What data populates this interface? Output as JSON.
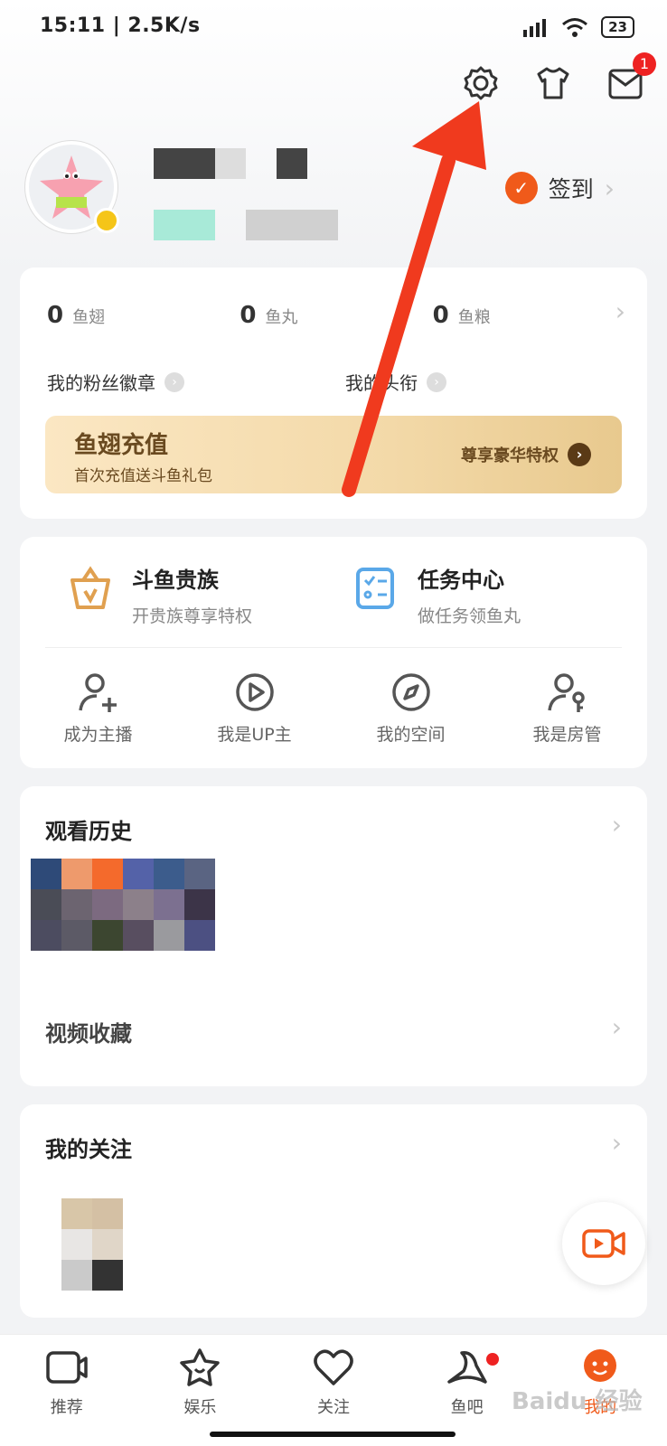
{
  "status_bar": {
    "time": "15:11 | 2.5K/s",
    "battery": "23"
  },
  "header": {
    "mail_badge": "1",
    "checkin_label": "签到"
  },
  "wallet": {
    "currencies": [
      {
        "value": "0",
        "unit": "鱼翅"
      },
      {
        "value": "0",
        "unit": "鱼丸"
      },
      {
        "value": "0",
        "unit": "鱼粮"
      }
    ],
    "fan_badge": "我的粉丝徽章",
    "title_label": "我的头衔",
    "recharge": {
      "title": "鱼翅充值",
      "subtitle": "首次充值送斗鱼礼包",
      "cta": "尊享豪华特权"
    }
  },
  "services": {
    "noble": {
      "title": "斗鱼贵族",
      "subtitle": "开贵族尊享特权"
    },
    "tasks": {
      "title": "任务中心",
      "subtitle": "做任务领鱼丸"
    },
    "grid": [
      {
        "label": "成为主播",
        "icon": "user-add-icon"
      },
      {
        "label": "我是UP主",
        "icon": "play-circle-icon"
      },
      {
        "label": "我的空间",
        "icon": "compass-icon"
      },
      {
        "label": "我是房管",
        "icon": "user-key-icon"
      }
    ]
  },
  "history": {
    "title": "观看历史",
    "video_fav": "视频收藏"
  },
  "follow": {
    "title": "我的关注"
  },
  "tabbar": {
    "tabs": [
      {
        "label": "推荐",
        "icon": "tv-icon"
      },
      {
        "label": "娱乐",
        "icon": "star-icon"
      },
      {
        "label": "关注",
        "icon": "heart-icon"
      },
      {
        "label": "鱼吧",
        "icon": "fish-bar-icon"
      },
      {
        "label": "我的",
        "icon": "profile-icon"
      }
    ]
  },
  "watermark": "Baidu 经验",
  "colors": {
    "accent": "#f05a1a",
    "badge": "#ee2222",
    "annotation_arrow": "#f03a1e"
  }
}
